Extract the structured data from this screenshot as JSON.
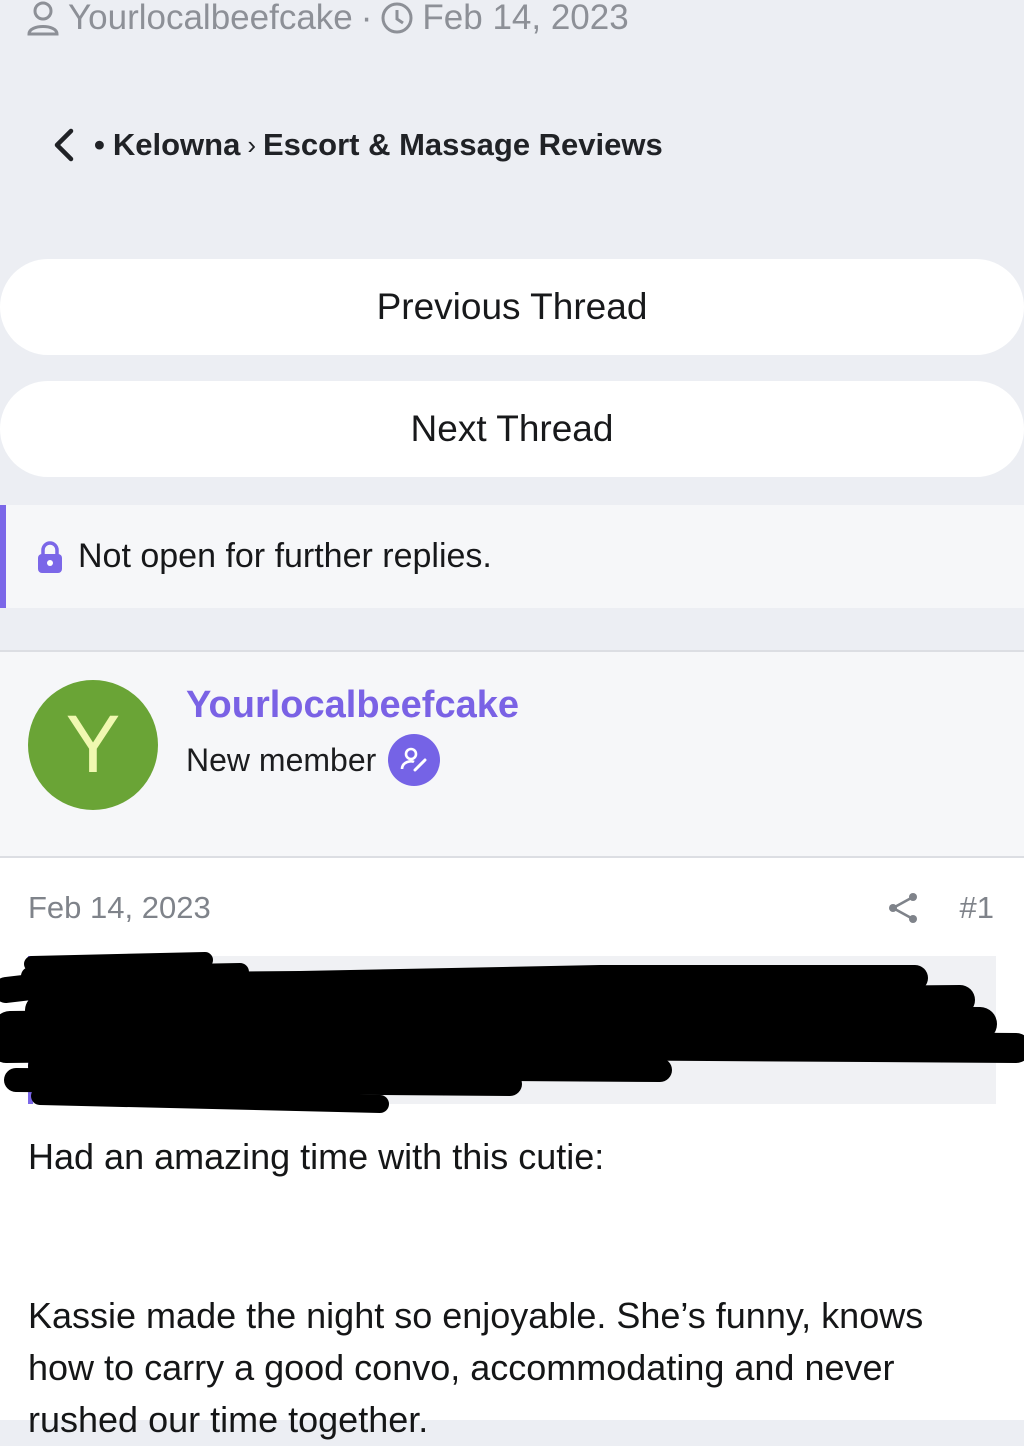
{
  "thread_meta": {
    "author": "Yourlocalbeefcake",
    "separator": "·",
    "date": "Feb 14, 2023"
  },
  "breadcrumb": {
    "bullet": "•",
    "location": "Kelowna",
    "separator": "›",
    "forum": "Escort & Massage Reviews"
  },
  "nav": {
    "previous": "Previous Thread",
    "next": "Next Thread"
  },
  "notice": {
    "text": "Not open for further replies."
  },
  "post_author": {
    "avatar_letter": "Y",
    "name": "Yourlocalbeefcake",
    "role": "New member",
    "avatar_color": "#6aa436",
    "accent_color": "#7a62e5"
  },
  "post": {
    "date": "Feb 14, 2023",
    "number": "#1",
    "line1": "Had an amazing time with this cutie:",
    "paragraph": "Kassie made the night so enjoyable. She’s funny, knows how to carry a good convo, accommodating and never rushed our time together."
  },
  "icons": [
    "user-icon",
    "clock-icon",
    "back-chevron-icon",
    "lock-icon",
    "edit-badge-icon",
    "share-icon"
  ]
}
